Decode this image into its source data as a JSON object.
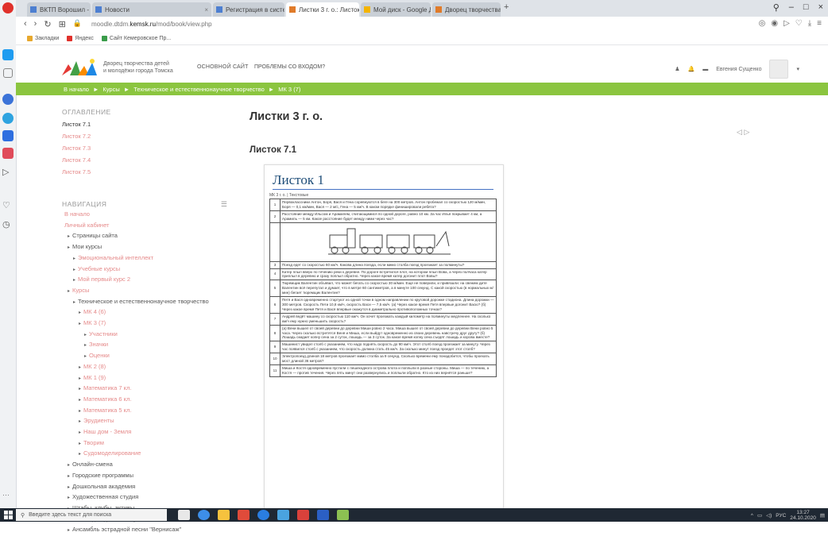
{
  "browser": {
    "tabs": [
      {
        "label": "ВКТП Ворошил - Почта! - ..."
      },
      {
        "label": "Новости"
      },
      {
        "label": "Регистрация в системе Безопасности"
      },
      {
        "label": "Листки 3 г. о.: Листок 7.1"
      },
      {
        "label": "Мой диск - Google Диск"
      },
      {
        "label": "Дворец творчества детей"
      }
    ],
    "url_prefix": "moodle.dtdm.",
    "url_domain": "kemsk.ru",
    "url_path": "/mod/book/view.php",
    "bookmarks": [
      {
        "label": "Закладки"
      },
      {
        "label": "Яндекс"
      },
      {
        "label": "Сайт Кемеровское Пр..."
      }
    ]
  },
  "header": {
    "site_name_line1": "Дворец творчества детей",
    "site_name_line2": "и молодёжи города Томска",
    "nav_main": "ОСНОВНОЙ САЙТ",
    "nav_help": "ПРОБЛЕМЫ СО ВХОДОМ?",
    "user_name": "Евгения Сущенко"
  },
  "breadcrumb": [
    "В начало",
    "Курсы",
    "Техническое и естественнонаучное творчество",
    "МК 3 (7)"
  ],
  "toc": {
    "title": "ОГЛАВЛЕНИЕ",
    "items": [
      {
        "label": "Листок 7.1"
      },
      {
        "label": "Листок 7.2"
      },
      {
        "label": "Листок 7.3"
      },
      {
        "label": "Листок 7.4"
      },
      {
        "label": "Листок 7.5"
      }
    ]
  },
  "navigation": {
    "title": "НАВИГАЦИЯ",
    "items": [
      {
        "label": "В начало",
        "indent": 0,
        "style": "red"
      },
      {
        "label": "Личный кабинет",
        "indent": 0,
        "style": "red"
      },
      {
        "label": "Страницы сайта",
        "indent": 1,
        "style": "dark"
      },
      {
        "label": "Мои курсы",
        "indent": 1,
        "style": "dark"
      },
      {
        "label": "Эмоциональный интеллект",
        "indent": 2,
        "style": "red"
      },
      {
        "label": "Учебные курсы",
        "indent": 2,
        "style": "red"
      },
      {
        "label": "Мой первый курс 2",
        "indent": 2,
        "style": "red"
      },
      {
        "label": "Курсы",
        "indent": 1,
        "style": "red"
      },
      {
        "label": "Техническое и естественнонаучное творчество",
        "indent": 2,
        "style": "dark"
      },
      {
        "label": "МК 4 (6)",
        "indent": 3,
        "style": "red"
      },
      {
        "label": "МК 3 (7)",
        "indent": 3,
        "style": "red"
      },
      {
        "label": "Участники",
        "indent": 4,
        "style": "red"
      },
      {
        "label": "Значки",
        "indent": 4,
        "style": "red"
      },
      {
        "label": "Оценки",
        "indent": 4,
        "style": "red"
      },
      {
        "label": "МК 2 (8)",
        "indent": 3,
        "style": "red"
      },
      {
        "label": "МК 1 (9)",
        "indent": 3,
        "style": "red"
      },
      {
        "label": "Математика 7 кл.",
        "indent": 3,
        "style": "red"
      },
      {
        "label": "Математика 6 кл.",
        "indent": 3,
        "style": "red"
      },
      {
        "label": "Математика 5 кл.",
        "indent": 3,
        "style": "red"
      },
      {
        "label": "Эрудиенты",
        "indent": 3,
        "style": "red"
      },
      {
        "label": "Наш дом - Земля",
        "indent": 3,
        "style": "red"
      },
      {
        "label": "Творим",
        "indent": 3,
        "style": "red"
      },
      {
        "label": "Судомоделирование",
        "indent": 3,
        "style": "red"
      },
      {
        "label": "Онлайн-смена",
        "indent": 1,
        "style": "dark"
      },
      {
        "label": "Городские программы",
        "indent": 1,
        "style": "dark"
      },
      {
        "label": "Дошкольная академия",
        "indent": 1,
        "style": "dark"
      },
      {
        "label": "Художественная студия",
        "indent": 1,
        "style": "dark"
      },
      {
        "label": "Штабы, клубы, активы",
        "indent": 1,
        "style": "dark"
      },
      {
        "label": "Школа для девочек \"Бусинка\"",
        "indent": 1,
        "style": "dark"
      },
      {
        "label": "Ансамбль эстрадной песни \"Вернисаж\"",
        "indent": 1,
        "style": "dark"
      }
    ]
  },
  "main": {
    "title": "Листки 3 г. о.",
    "subtitle": "Листок 7.1",
    "page_nav": "◁ ▷"
  },
  "document": {
    "title": "Листок 1",
    "subtitle": "МК 3 г. о. | Текстовые",
    "rows": [
      {
        "n": "1",
        "text": "Первоклассники Антон, Боря, Вася и Гена соревнуются в беге на 300 метров. Антон пробежал со скоростью 120 м/мин, Боря — 0,1 км/мин, Вася — 2 м/с, Гена — 5 км/ч. В каком порядке финишировали ребята?"
      },
      {
        "n": "2",
        "text": "Расстояние между Ильсом и Арамилем, считающимися по одной дороге, равно 10 км. За час Илья покрывает 4 км, а Арамиль — 5 км. Какое расстояние будет между ними через час?"
      },
      {
        "n": "",
        "text": "",
        "picture": true
      },
      {
        "n": "3",
        "text": "Поезд едет со скоростью 60 км/ч. Какова длина поезда, если мимо столба поезд проезжает за полминуты?"
      },
      {
        "n": "4",
        "text": "Катер плыл вверх по течению реки к деревне. По дороге встретился плот, на котором плыл Вова, а через полчаса катер приплыл в деревню и сразу поплыл обратно. Через какое время катер догонит плот Вовы?"
      },
      {
        "n": "5",
        "text": "Тюремщик Валентин объявил, что может бегать со скоростью 30 м/мин. Еще не поверили, и привязали: на свежем дите Валентин всё перепутал и думает, что в метре 60 сантиметров, а в минуте 100 секунд. С какой скоростью (в нормальных м/мин) бегает тюремщик Валентин?"
      },
      {
        "n": "6",
        "text": "Петя и Вася одновременно стартуют из одной точки в одном направлении по круговой дорожке стадиона. Длина дорожки — 300 метров. Скорость Пети 10,8 км/ч, скорость Васи — 7,5 км/ч. (а) Через какое время Петя впервые догонит Васю? (б) Через какое время Петя и Вася впервые окажутся в диаметрально противоположных точках?"
      },
      {
        "n": "7",
        "text": "Андрей ведёт машину со скоростью 110 км/ч. Он хочет проезжать каждый километр на полминуты медленнее. На сколько км/ч ему нужно уменьшить скорость?"
      },
      {
        "n": "8",
        "text": "(а) Вени вышел от своей деревни до деревни Миши ровно 2 часа. Миша вышел от своей деревни до деревни Вени ровно 5 часа. Через сколько встретятся Веня и Миша, если выйдут одновременно из своих деревень навстречу друг другу? (б) Лошадь скидает копну сена за 2 суток, лошадь — за 3 суток. За какое время копну сена съедят лошадь и корова вместе?"
      },
      {
        "n": "9",
        "text": "Машинист увидел столб с указанием, что надо поднять скорость до 90 км/ч. Этот столб поезд проезжает за минуту. Через час появился столб с указанием, что скорость должна стать 45 км/ч. За сколько минут поезд проедет этот столб?"
      },
      {
        "n": "10",
        "text": "Электропоезд длиной 18 метров проезжает мимо столба за 9 секунд. Сколько времени ему понадобится, чтобы проехать мост длиной 36 метров?"
      },
      {
        "n": "11",
        "text": "Миша и Костя одновременно пустили с пешеходного острова плота и поплыли в разные стороны. Миша — по течению, а Костя — против течения. Через пять минут они развернулись и поплыли обратно. Кто из них вернётся раньше?"
      }
    ]
  },
  "taskbar": {
    "search_placeholder": "Введите здесь текст для поиска",
    "lang": "РУС",
    "time": "13:27",
    "date": "24.10.2020"
  }
}
